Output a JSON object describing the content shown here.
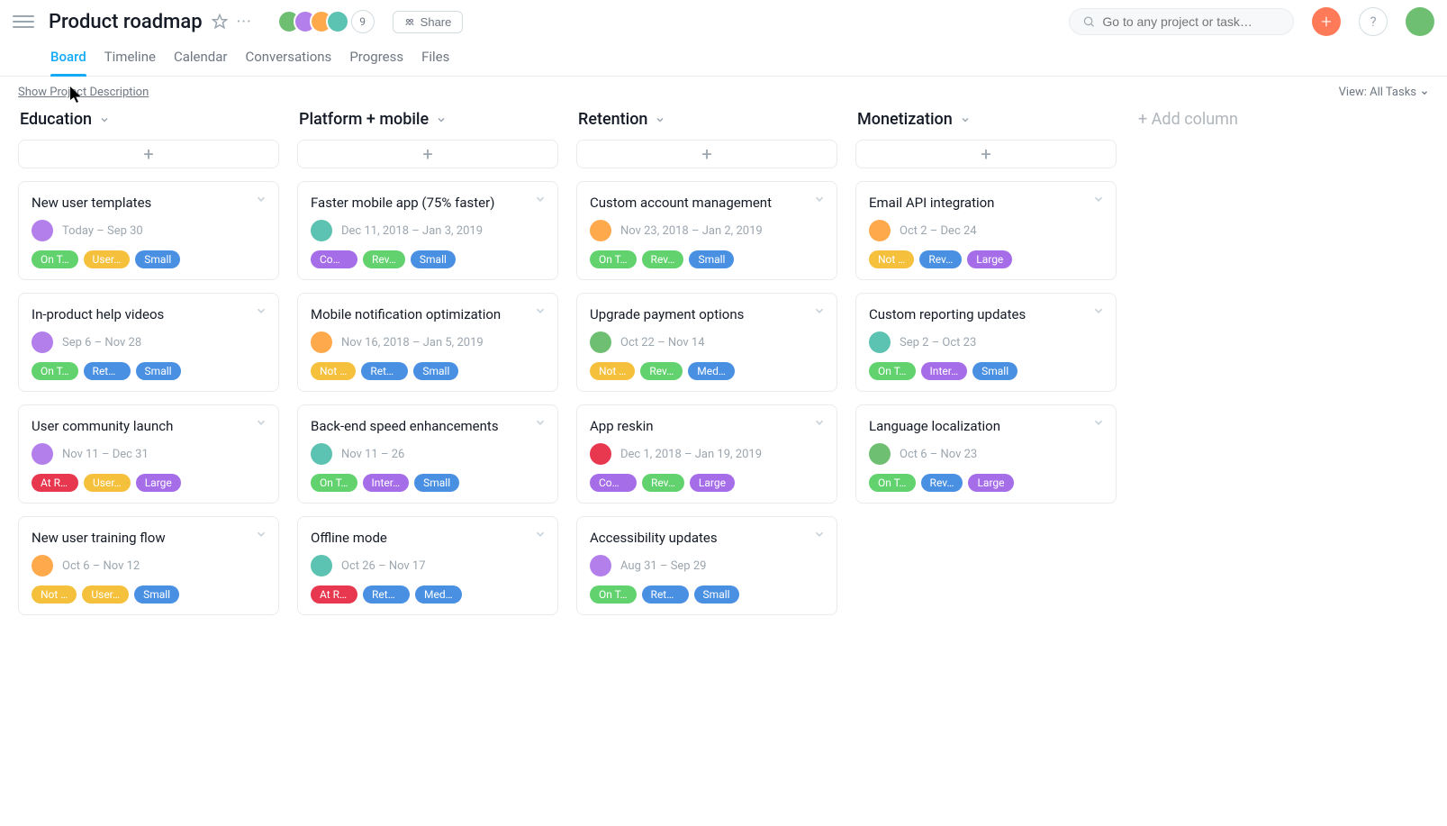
{
  "header": {
    "title": "Product roadmap",
    "member_overflow": "9",
    "share_label": "Share",
    "search_placeholder": "Go to any project or task…",
    "help_label": "?"
  },
  "tabs": [
    {
      "label": "Board",
      "active": true
    },
    {
      "label": "Timeline",
      "active": false
    },
    {
      "label": "Calendar",
      "active": false
    },
    {
      "label": "Conversations",
      "active": false
    },
    {
      "label": "Progress",
      "active": false
    },
    {
      "label": "Files",
      "active": false
    }
  ],
  "subbar": {
    "show_description": "Show Project Description",
    "view_all": "View: All Tasks"
  },
  "add_column_label": "+ Add column",
  "avatar_colors": {
    "topbar": [
      "#6fbf73",
      "#b37feb",
      "#ffa94d",
      "#5cc2b1"
    ],
    "profile": "#6fbf73"
  },
  "tag_defs": {
    "on_track": {
      "label": "On T…",
      "color": "green"
    },
    "not": {
      "label": "Not …",
      "color": "yellow"
    },
    "at_risk": {
      "label": "At Ri…",
      "color": "red"
    },
    "com": {
      "label": "Com…",
      "color": "purple"
    },
    "user": {
      "label": "User…",
      "color": "yellow"
    },
    "rete": {
      "label": "Rete…",
      "color": "blue"
    },
    "reten": {
      "label": "Rete…",
      "color": "blue"
    },
    "retenb": {
      "label": "Rete…",
      "color": "blue"
    },
    "rev": {
      "label": "Rev…",
      "color": "green"
    },
    "rev_b": {
      "label": "Rev…",
      "color": "blue"
    },
    "inter": {
      "label": "Inter…",
      "color": "purple"
    },
    "small": {
      "label": "Small",
      "color": "blue"
    },
    "med": {
      "label": "Med…",
      "color": "blue"
    },
    "large": {
      "label": "Large",
      "color": "purple"
    }
  },
  "columns": [
    {
      "name": "Education",
      "cards": [
        {
          "title": "New user templates",
          "dates": "Today – Sep 30",
          "avatar": "#b37feb",
          "tags": [
            "on_track",
            "user",
            "small"
          ]
        },
        {
          "title": "In-product help videos",
          "dates": "Sep 6 – Nov 28",
          "avatar": "#b37feb",
          "tags": [
            "on_track",
            "rete",
            "small"
          ]
        },
        {
          "title": "User community launch",
          "dates": "Nov 11 – Dec 31",
          "avatar": "#b37feb",
          "tags": [
            "at_risk",
            "user",
            "large"
          ]
        },
        {
          "title": "New user training flow",
          "dates": "Oct 6 – Nov 12",
          "avatar": "#ffa94d",
          "tags": [
            "not",
            "user",
            "small"
          ]
        }
      ]
    },
    {
      "name": "Platform + mobile",
      "cards": [
        {
          "title": "Faster mobile app (75% faster)",
          "dates": "Dec 11, 2018 – Jan 3, 2019",
          "avatar": "#5cc2b1",
          "tags": [
            "com",
            "rev",
            "small"
          ]
        },
        {
          "title": "Mobile notification optimization",
          "dates": "Nov 16, 2018 – Jan 5, 2019",
          "avatar": "#ffa94d",
          "tags": [
            "not",
            "reten",
            "small"
          ]
        },
        {
          "title": "Back-end speed enhancements",
          "dates": "Nov 11 – 26",
          "avatar": "#5cc2b1",
          "tags": [
            "on_track",
            "inter",
            "small"
          ]
        },
        {
          "title": "Offline mode",
          "dates": "Oct 26 – Nov 17",
          "avatar": "#5cc2b1",
          "tags": [
            "at_risk",
            "reten",
            "med"
          ]
        }
      ]
    },
    {
      "name": "Retention",
      "cards": [
        {
          "title": "Custom account management",
          "dates": "Nov 23, 2018 – Jan 2, 2019",
          "avatar": "#ffa94d",
          "tags": [
            "on_track",
            "rev",
            "small"
          ]
        },
        {
          "title": "Upgrade payment options",
          "dates": "Oct 22 – Nov 14",
          "avatar": "#6fbf73",
          "tags": [
            "not",
            "rev",
            "med"
          ]
        },
        {
          "title": "App reskin",
          "dates": "Dec 1, 2018 – Jan 19, 2019",
          "avatar": "#e8384f",
          "tags": [
            "com",
            "rev",
            "large"
          ]
        },
        {
          "title": "Accessibility updates",
          "dates": "Aug 31 – Sep 29",
          "avatar": "#b37feb",
          "tags": [
            "on_track",
            "retenb",
            "small"
          ]
        }
      ]
    },
    {
      "name": "Monetization",
      "cards": [
        {
          "title": "Email API integration",
          "dates": "Oct 2 – Dec 24",
          "avatar": "#ffa94d",
          "tags": [
            "not",
            "rev_b",
            "large"
          ]
        },
        {
          "title": "Custom reporting updates",
          "dates": "Sep 2 – Oct 23",
          "avatar": "#5cc2b1",
          "tags": [
            "on_track",
            "inter",
            "small"
          ]
        },
        {
          "title": "Language localization",
          "dates": "Oct 6 – Nov 23",
          "avatar": "#6fbf73",
          "tags": [
            "on_track",
            "rev_b",
            "large"
          ]
        }
      ]
    }
  ]
}
